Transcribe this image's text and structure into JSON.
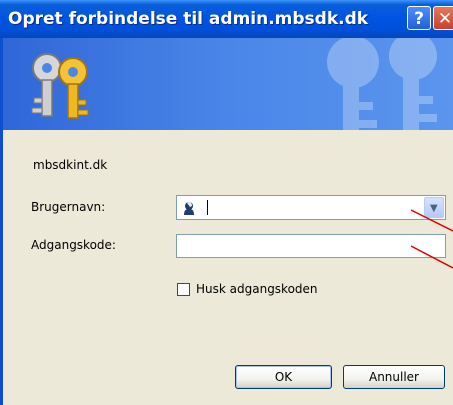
{
  "window": {
    "title": "Opret forbindelse til admin.mbsdk.dk",
    "help_glyph": "?",
    "close_glyph": "✕"
  },
  "dialog": {
    "server": "mbsdkint.dk",
    "username_label": "Brugernavn:",
    "username_value": "",
    "password_label": "Adgangskode:",
    "password_value": "",
    "remember_label": "Husk adgangskoden",
    "remember_checked": false,
    "ok_label": "OK",
    "cancel_label": "Annuller"
  },
  "icons": {
    "banner": "keys-icon",
    "user": "user-icon",
    "dropdown": "chevron-down-icon"
  },
  "colors": {
    "titlebar": "#0054e3",
    "banner": "#4a86e8",
    "dialog_bg": "#ece9d8",
    "annotation": "#e00000"
  }
}
